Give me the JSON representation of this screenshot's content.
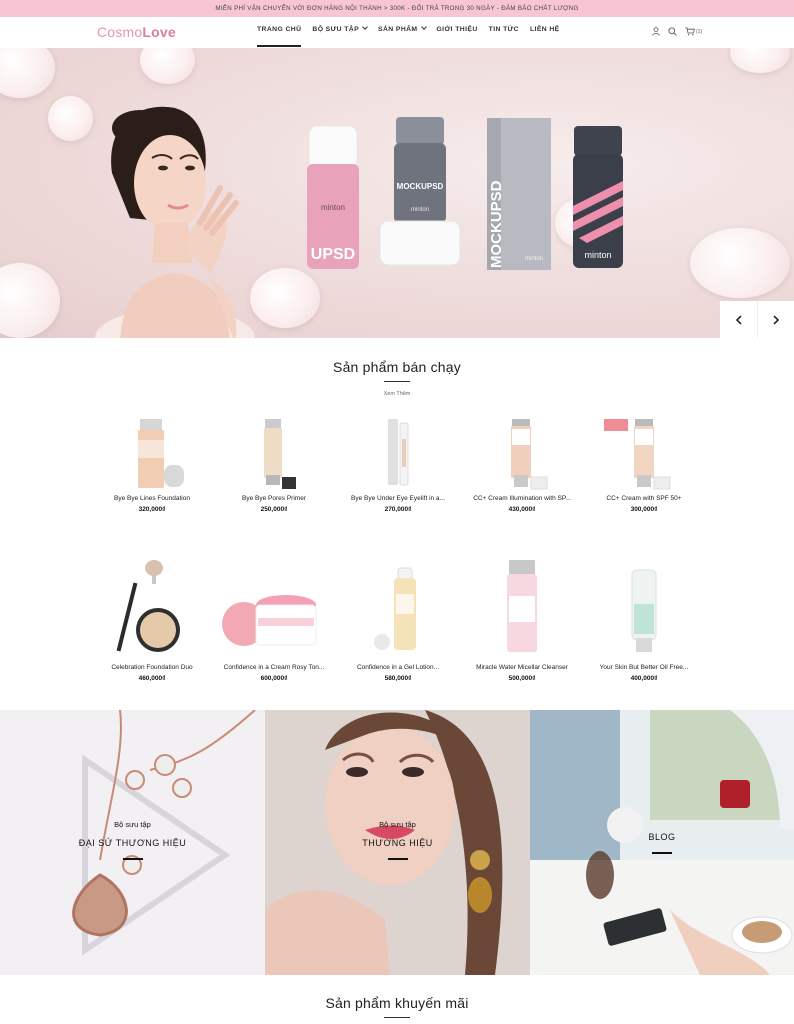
{
  "topbar": {
    "text": "MIỄN PHÍ VẬN CHUYỂN VỚI ĐƠN HÀNG NỘI THÀNH > 300K - ĐỔI TRẢ TRONG 30 NGÀY - ĐẢM BẢO CHẤT LƯỢNG"
  },
  "header": {
    "logo_light": "Cosmo",
    "logo_bold": "Love",
    "nav": [
      {
        "label": "TRANG CHỦ"
      },
      {
        "label": "BỘ SƯU TẬP"
      },
      {
        "label": "SẢN PHẨM"
      },
      {
        "label": "GIỚI THIỆU"
      },
      {
        "label": "TIN TỨC"
      },
      {
        "label": "LIÊN HỆ"
      }
    ],
    "cart_count": "(1)"
  },
  "hero": {
    "products": [
      {
        "brand": "minton",
        "label": "UPSD"
      },
      {
        "brand": "minton",
        "label": "MOCKUPSD"
      },
      {
        "brand": "minton",
        "label": "MOCKUPSD"
      },
      {
        "brand": "minton",
        "label": ""
      }
    ]
  },
  "bestsellers": {
    "title": "Sản phẩm bán chạy",
    "more": "Xem Thêm",
    "items": [
      {
        "name": "Bye Bye Lines Foundation",
        "price": "320,000₫"
      },
      {
        "name": "Bye Bye Pores Primer",
        "price": "250,000₫"
      },
      {
        "name": "Bye Bye Under Eye Eyelift in a...",
        "price": "270,000₫"
      },
      {
        "name": "CC+ Cream Illumination with SP...",
        "price": "430,000₫"
      },
      {
        "name": "CC+ Cream with SPF 50+",
        "price": "300,000₫"
      },
      {
        "name": "Celebration Foundation Duo",
        "price": "460,000₫"
      },
      {
        "name": "Confidence in a Cream Rosy Ton...",
        "price": "600,000₫"
      },
      {
        "name": "Confidence in a Gel Lotion...",
        "price": "580,000₫"
      },
      {
        "name": "Miracle Water Micellar Cleanser",
        "price": "500,000₫"
      },
      {
        "name": "Your Skin But Better Oil Free...",
        "price": "400,000₫"
      }
    ]
  },
  "banners": [
    {
      "sub": "Bộ sưu tập",
      "big": "ĐẠI SỨ THƯƠNG HIỆU"
    },
    {
      "sub": "Bộ sưu tập",
      "big": "THƯƠNG HIỆU"
    },
    {
      "sub": "",
      "big": "BLOG"
    }
  ],
  "promo": {
    "title": "Sản phẩm khuyến mãi"
  },
  "colors": {
    "accent": "#e07d97",
    "topbar": "#f7c6d2"
  }
}
